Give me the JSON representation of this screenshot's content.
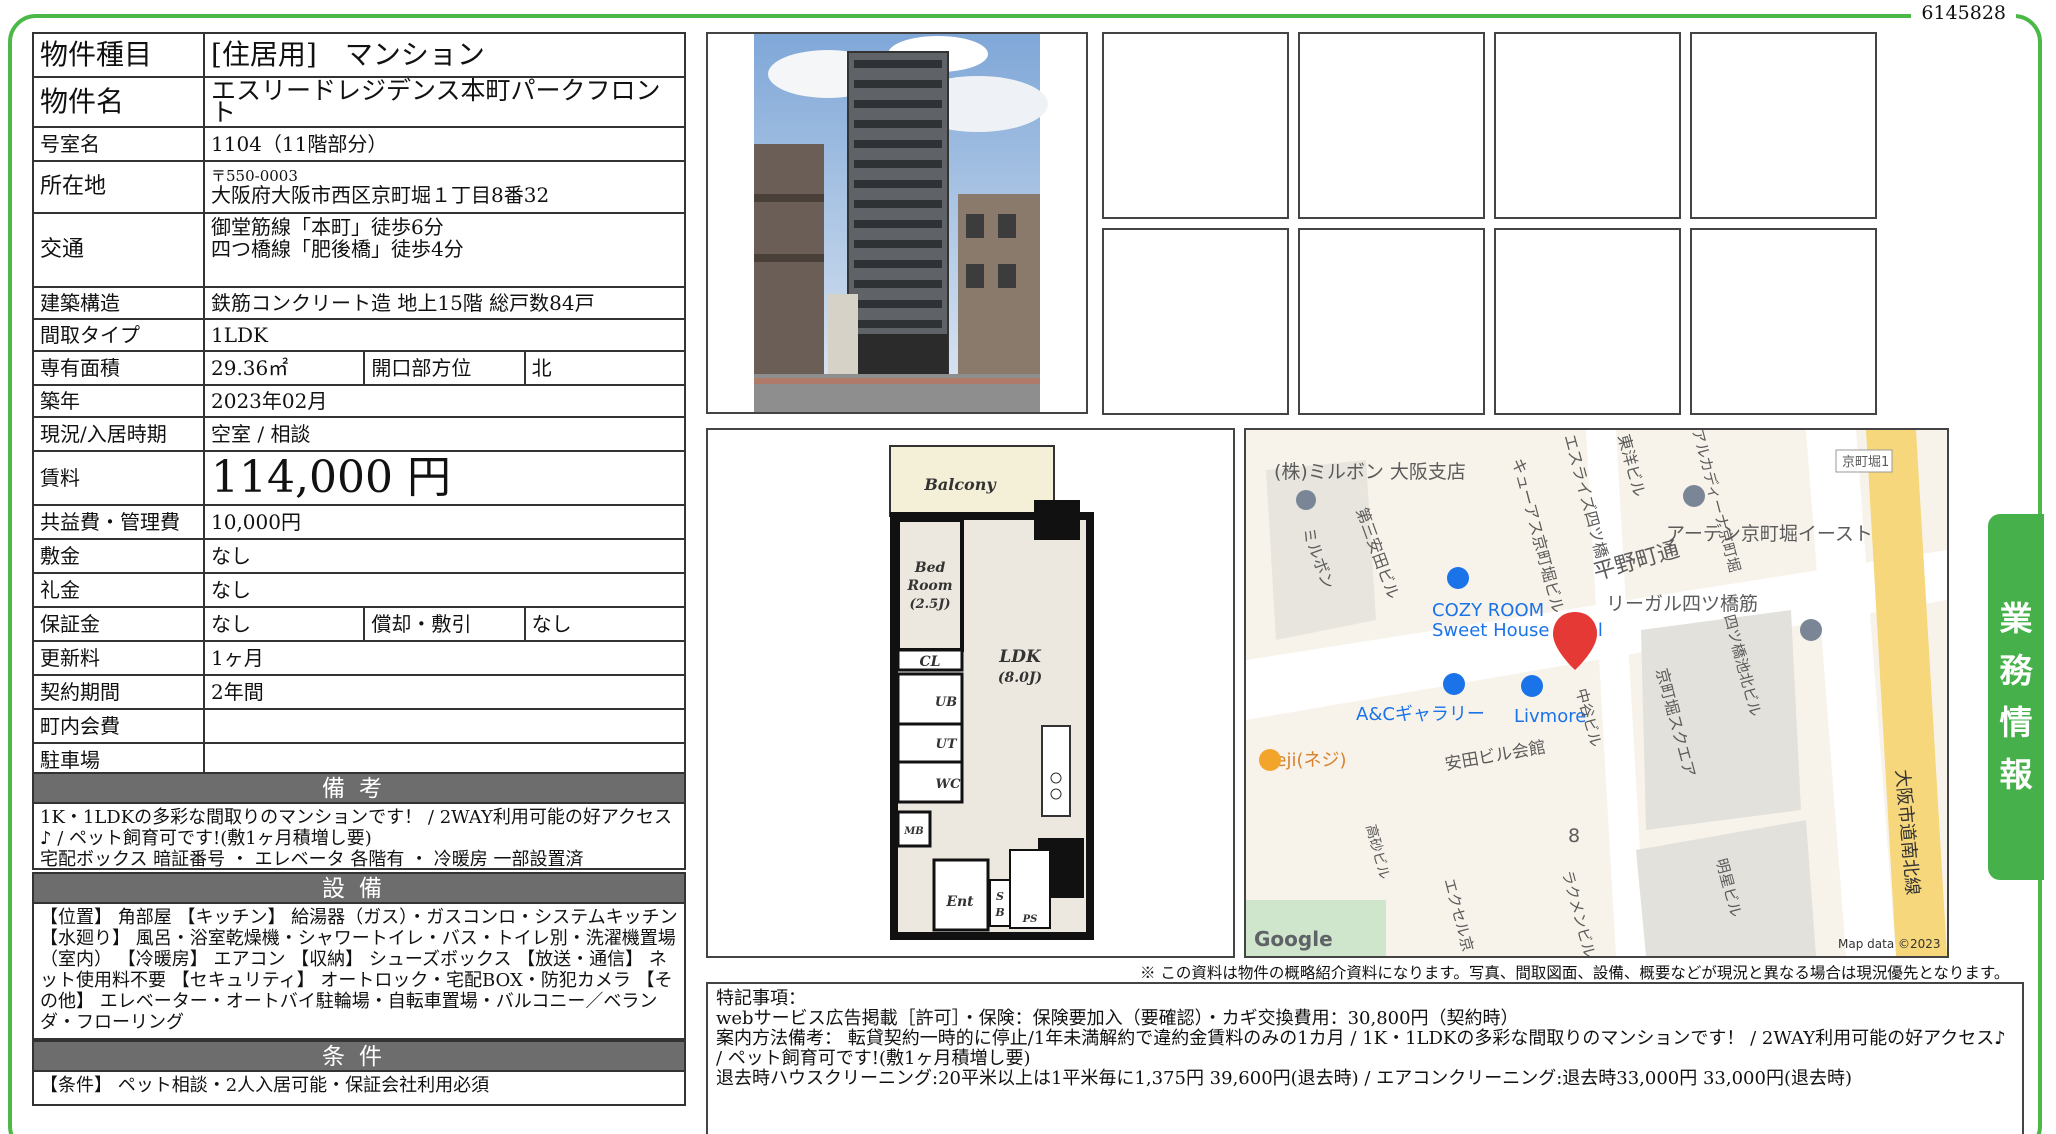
{
  "doc_id": "6145828",
  "side_tab": "業務情報",
  "rows": {
    "type": {
      "label": "物件種目",
      "value": "[住居用]　マンション"
    },
    "name": {
      "label": "物件名",
      "value": "エスリードレジデンス本町パークフロント"
    },
    "room": {
      "label": "号室名",
      "value": "1104（11階部分）"
    },
    "address": {
      "label": "所在地",
      "postal": "〒550-0003",
      "value": "大阪府大阪市西区京町堀１丁目8番32"
    },
    "access": {
      "label": "交通",
      "line1": "御堂筋線「本町」徒歩6分",
      "line2": "四つ橋線「肥後橋」徒歩4分"
    },
    "structure": {
      "label": "建築構造",
      "value": "鉄筋コンクリート造 地上15階 総戸数84戸"
    },
    "layout": {
      "label": "間取タイプ",
      "value": "1LDK"
    },
    "area": {
      "label": "専有面積",
      "value": "29.36㎡",
      "sub_label": "開口部方位",
      "sub_value": "北"
    },
    "built": {
      "label": "築年",
      "value": "2023年02月"
    },
    "status": {
      "label": "現況/入居時期",
      "value": "空室 / 相談"
    },
    "rent": {
      "label": "賃料",
      "value": "114,000 円"
    },
    "fee": {
      "label": "共益費・管理費",
      "value": "10,000円"
    },
    "deposit": {
      "label": "敷金",
      "value": "なし"
    },
    "key_money": {
      "label": "礼金",
      "value": "なし"
    },
    "guarantee": {
      "label": "保証金",
      "value": "なし",
      "sub_label": "償却・敷引",
      "sub_value": "なし"
    },
    "renewal": {
      "label": "更新料",
      "value": "1ヶ月"
    },
    "term": {
      "label": "契約期間",
      "value": "2年間"
    },
    "community": {
      "label": "町内会費",
      "value": ""
    },
    "parking": {
      "label": "駐車場",
      "value": ""
    }
  },
  "biko": {
    "title": "備考",
    "line1": "1K・1LDKの多彩な間取りのマンションです！ / 2WAY利用可能の好アクセス♪ / ペット飼育可です!(敷1ヶ月積増し要)",
    "line2": "宅配ボックス 暗証番号 ・ エレベータ 各階有 ・ 冷暖房 一部設置済"
  },
  "setsubi": {
    "title": "設備",
    "text": "【位置】 角部屋 【キッチン】 給湯器（ガス）・ガスコンロ・システムキッチン 【水廻り】 風呂・浴室乾燥機・シャワートイレ・バス・トイレ別・洗濯機置場（室内） 【冷暖房】 エアコン 【収納】 シューズボックス 【放送・通信】 ネット使用料不要 【セキュリティ】 オートロック・宅配BOX・防犯カメラ 【その他】 エレベーター・オートバイ駐輪場・自転車置場・バルコニー／ベランダ・フローリング"
  },
  "joken": {
    "title": "条件",
    "text": "【条件】 ペット相談・2人入居可能・保証会社利用必須"
  },
  "floorplan": {
    "balcony": "Balcony",
    "bedroom": "Bed",
    "bedroom2": "Room",
    "bedroom_size": "(2.5J)",
    "ldk": "LDK",
    "ldk_size": "(8.0J)",
    "cl": "CL",
    "ub": "UB",
    "ut": "UT",
    "wc": "WC",
    "mb": "MB",
    "ent": "Ent",
    "sb1": "S",
    "sb2": "B",
    "ps": "PS"
  },
  "map": {
    "poi_milbon": "(株)ミルボン 大阪支店",
    "cure": "キューアス京町堀ビル",
    "esuraizu": "エスライズ四ツ橋",
    "toyo": "東洋ビル",
    "aruka": "アルカディーナ京町堀",
    "station_sign": "京町堀1",
    "arden": "アーデン京町堀イースト",
    "daisan": "第三安田ビル",
    "milbon_bldg": "ミルボン",
    "hirano": "平野町通",
    "regal": "リーガル四ツ橋筋",
    "yotsubashi_bldg": "四ツ橋池北ビル",
    "cozy1": "COZY ROOM",
    "cozy2": "Sweet House Hotel",
    "kyomachibori_sq": "京町堀スクエア",
    "ac_gallery": "A&Cギャラリー",
    "livmore": "Livmore",
    "nakatani": "中谷ビル",
    "neji": "neji(ネジ)",
    "yasuda": "安田ビル会館",
    "block": "8",
    "doro": "大阪市道南北線",
    "kosei": "高砂ビル",
    "excel": "エクセル京",
    "rakumen": "ラクメンビル",
    "meisei": "明星ビル",
    "google": "Google",
    "attribution": "Map data ©2023"
  },
  "disclaimer": "※ この資料は物件の概略紹介資料になります。写真、間取図面、設備、概要などが現況と異なる場合は現況優先となります。",
  "remarks": {
    "title": "特記事項：",
    "line1": "webサービス広告掲載［許可］・保険：保険要加入（要確認）・カギ交換費用：30,800円（契約時）",
    "line2": "案内方法備考： 転貸契約一時的に停止/1年未満解約で違約金賃料のみの1カ月 / 1K・1LDKの多彩な間取りのマンションです！ / 2WAY利用可能の好アクセス♪ / ペット飼育可です!(敷1ヶ月積増し要)",
    "line3": "退去時ハウスクリーニング:20平米以上は1平米毎に1,375円 39,600円(退去時) / エアコンクリーニング:退去時33,000円 33,000円(退去時)"
  },
  "colors": {
    "frame": "#4cb848",
    "band": "#6d6d6d",
    "map_pin": "#e53935",
    "poi": "#1a73e8"
  }
}
